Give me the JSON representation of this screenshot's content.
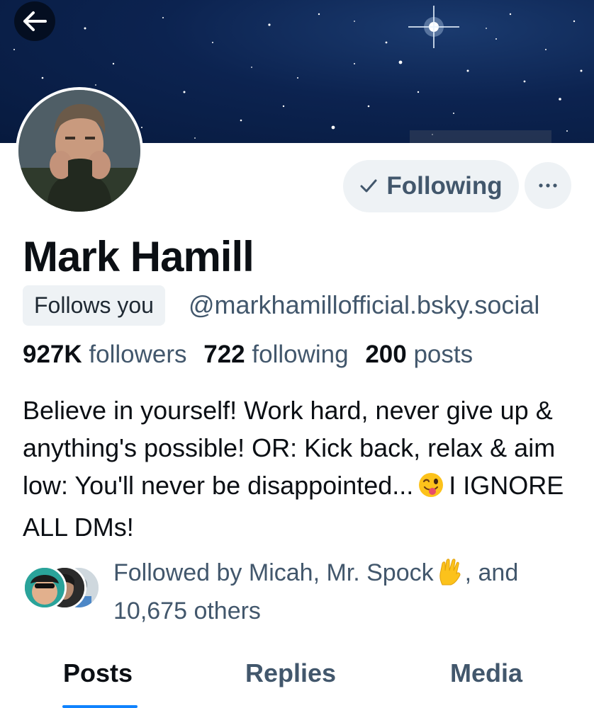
{
  "profile": {
    "name": "Mark Hamill",
    "follows_you_label": "Follows you",
    "handle": "@markhamillofficial.bsky.social",
    "bio_part1": "Believe in yourself! Work hard, never give up & anything's possible! OR: Kick back, relax & aim low: You'll never be disappointed...",
    "bio_part2": "I IGNORE ALL DMs!"
  },
  "actions": {
    "following_label": "Following",
    "more_label": "···"
  },
  "stats": {
    "followers_count": "927K",
    "followers_label": "followers",
    "following_count": "722",
    "following_label": "following",
    "posts_count": "200",
    "posts_label": "posts"
  },
  "followed_by": {
    "part1": "Followed by Micah, Mr. Spock",
    "part2": ", and 10,675 others"
  },
  "tabs": [
    {
      "label": "Posts",
      "active": true
    },
    {
      "label": "Replies",
      "active": false
    },
    {
      "label": "Media",
      "active": false
    }
  ],
  "icons": {
    "back": "arrow-left-icon",
    "check": "check-icon",
    "more": "ellipsis-icon",
    "winking_emoji": "winking-tongue-emoji",
    "vulcan_salute": "vulcan-salute-emoji"
  },
  "colors": {
    "accent": "#1083fe",
    "muted_text": "#42576c",
    "chip_bg": "#eef2f5",
    "banner_bg": "#0c2350"
  }
}
